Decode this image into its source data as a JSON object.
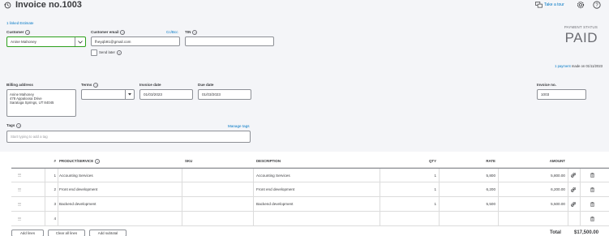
{
  "header": {
    "title": "Invoice no.1003",
    "take_tour": "Take a tour",
    "linked_estimate": "1 linked Estimate"
  },
  "customer": {
    "label": "Customer",
    "value": "Anine Mahoney",
    "email_label": "Customer email",
    "email_value": "fheyqb91@gmail.com",
    "cc_bcc": "Cc/Bcc",
    "tin_label": "TIN",
    "send_later": "Send later"
  },
  "payment": {
    "status_label": "PAYMENT STATUS",
    "status": "PAID",
    "payment_link": "1 payment",
    "payment_note": "made on 01/11/2023"
  },
  "billing": {
    "label": "Billing address",
    "lines": [
      "Anine Mahoney",
      "478 Appaloosa Drive",
      "Saratoga Springs, UT  84045"
    ],
    "terms_label": "Terms",
    "terms_value": "",
    "invoice_date_label": "Invoice date",
    "invoice_date": "01/03/2023",
    "due_date_label": "Due date",
    "due_date": "01/03/2023",
    "invoice_no_label": "Invoice no.",
    "invoice_no": "1003"
  },
  "tags": {
    "label": "Tags",
    "manage": "Manage tags",
    "placeholder": "Start typing to add a tag"
  },
  "table": {
    "headers": [
      "#",
      "PRODUCT/SERVICE",
      "SKU",
      "DESCRIPTION",
      "QTY",
      "RATE",
      "AMOUNT"
    ],
    "rows": [
      {
        "num": "1",
        "product": "Accounting Services",
        "sku": "",
        "description": "Accounting Services",
        "qty": "1",
        "rate": "5,800",
        "amount": "5,800.00"
      },
      {
        "num": "2",
        "product": "Front end development",
        "sku": "",
        "description": "Front end development",
        "qty": "1",
        "rate": "6,200",
        "amount": "6,200.00"
      },
      {
        "num": "3",
        "product": "Backend development",
        "sku": "",
        "description": "Backend development",
        "qty": "1",
        "rate": "5,500",
        "amount": "5,500.00"
      },
      {
        "num": "4",
        "product": "",
        "sku": "",
        "description": "",
        "qty": "",
        "rate": "",
        "amount": ""
      }
    ]
  },
  "footer": {
    "add_lines": "Add lines",
    "clear_all": "Clear all lines",
    "add_subtotal": "Add subtotal",
    "total_label": "Total",
    "total_value": "$17,500.00"
  },
  "colors": {
    "accent": "#0077c5",
    "focus": "#2ca01c",
    "background": "#f4f5f8"
  }
}
